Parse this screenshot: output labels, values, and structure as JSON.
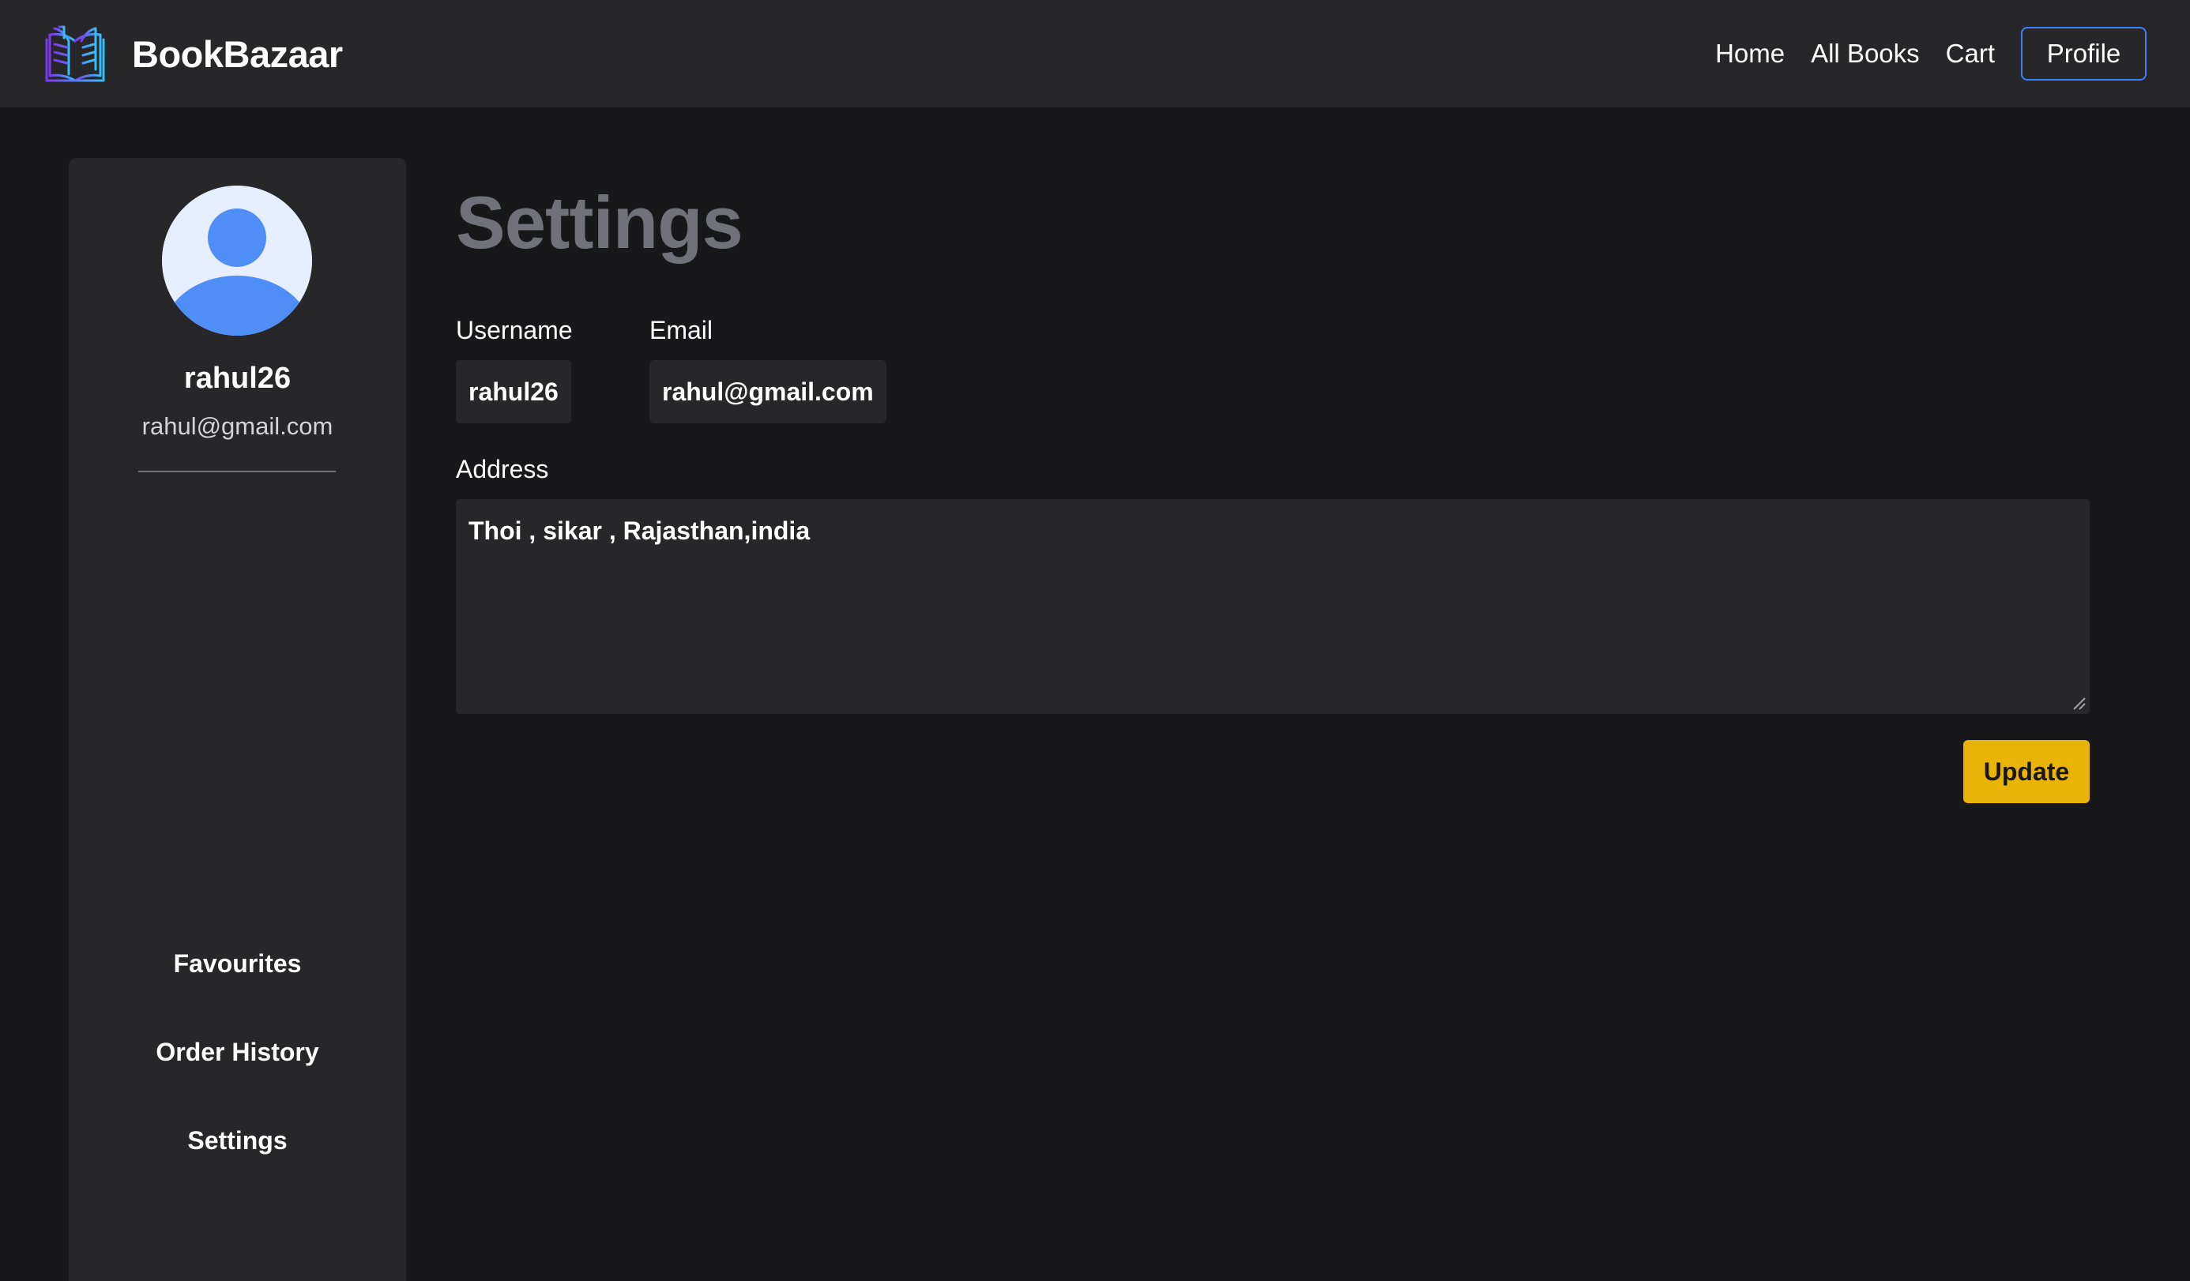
{
  "navbar": {
    "brand_name": "BookBazaar",
    "logo_icon": "open-book-icon",
    "links": [
      "Home",
      "All Books",
      "Cart"
    ],
    "profile_label": "Profile",
    "accent_color": "#3b82f6"
  },
  "sidebar": {
    "avatar_icon": "user-avatar-icon",
    "username": "rahul26",
    "email": "rahul@gmail.com",
    "items": [
      {
        "label": "Favourites"
      },
      {
        "label": "Order History"
      },
      {
        "label": "Settings"
      }
    ]
  },
  "main": {
    "title": "Settings",
    "username_label": "Username",
    "username_value": "rahul26",
    "email_label": "Email",
    "email_value": "rahul@gmail.com",
    "address_label": "Address",
    "address_value": "Thoi , sikar , Rajasthan,india",
    "update_label": "Update",
    "update_color": "#eab308"
  }
}
